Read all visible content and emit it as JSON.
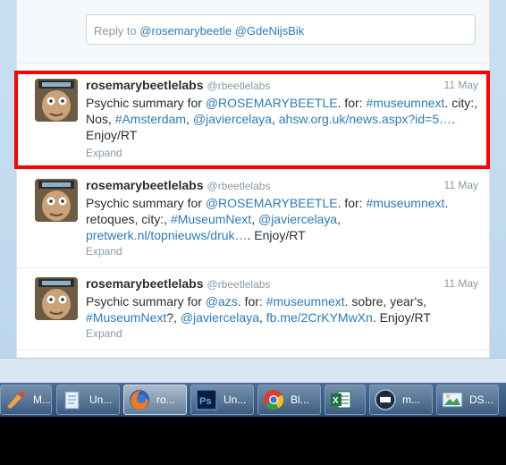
{
  "reply": {
    "prefix": "Reply to ",
    "mention1": "@rosemarybeetle",
    "mention2": "@GdeNijsBik"
  },
  "tweets": [
    {
      "name": "rosemarybeetlelabs",
      "handle": "@rbeetlelabs",
      "time": "11 May",
      "t1": "Psychic summary for ",
      "l1": "@ROSEMARYBEETLE",
      "t2": ". for: ",
      "l2": "#museumnext",
      "t3": ". city:, Nos, ",
      "l3": "#Amsterdam",
      "t4": ", ",
      "l4": "@javiercelaya",
      "t5": ", ",
      "l5": "ahsw.org.uk/news.aspx?id=5…",
      "t6": ". Enjoy/RT",
      "expand": "Expand",
      "highlighted": true
    },
    {
      "name": "rosemarybeetlelabs",
      "handle": "@rbeetlelabs",
      "time": "11 May",
      "t1": "Psychic summary for ",
      "l1": "@ROSEMARYBEETLE",
      "t2": ". for: ",
      "l2": "#museumnext",
      "t3": ". retoques, city:, ",
      "l3": "#MuseumNext",
      "t4": ", ",
      "l4": "@javiercelaya",
      "t5": ", ",
      "l5": "pretwerk.nl/topnieuws/druk…",
      "t6": ". Enjoy/RT",
      "expand": "Expand",
      "highlighted": false
    },
    {
      "name": "rosemarybeetlelabs",
      "handle": "@rbeetlelabs",
      "time": "11 May",
      "t1": "Psychic summary for ",
      "l1": "@azs",
      "t2": ". for: ",
      "l2": "#museumnext",
      "t3": ". sobre, year's, ",
      "l3": "#MuseumNext",
      "t4": "?, ",
      "l4": "@javiercelaya",
      "t5": ", ",
      "l5": "fb.me/2CrKYMwXn",
      "t6": ". Enjoy/RT",
      "expand": "Expand",
      "highlighted": false
    }
  ],
  "taskbar": [
    {
      "label": "M...",
      "icon": "paint-brush-icon"
    },
    {
      "label": "Un...",
      "icon": "notepad-icon"
    },
    {
      "label": "ro...",
      "icon": "firefox-icon",
      "active": true
    },
    {
      "label": "Un...",
      "icon": "photoshop-icon"
    },
    {
      "label": "Bl...",
      "icon": "chrome-icon"
    },
    {
      "label": "",
      "icon": "excel-icon"
    },
    {
      "label": "m...",
      "icon": "video-icon"
    },
    {
      "label": "DS...",
      "icon": "photo-viewer-icon"
    }
  ],
  "colors": {
    "link": "#2b7bb9",
    "highlight": "#ff0000",
    "muted": "#8899a6"
  }
}
